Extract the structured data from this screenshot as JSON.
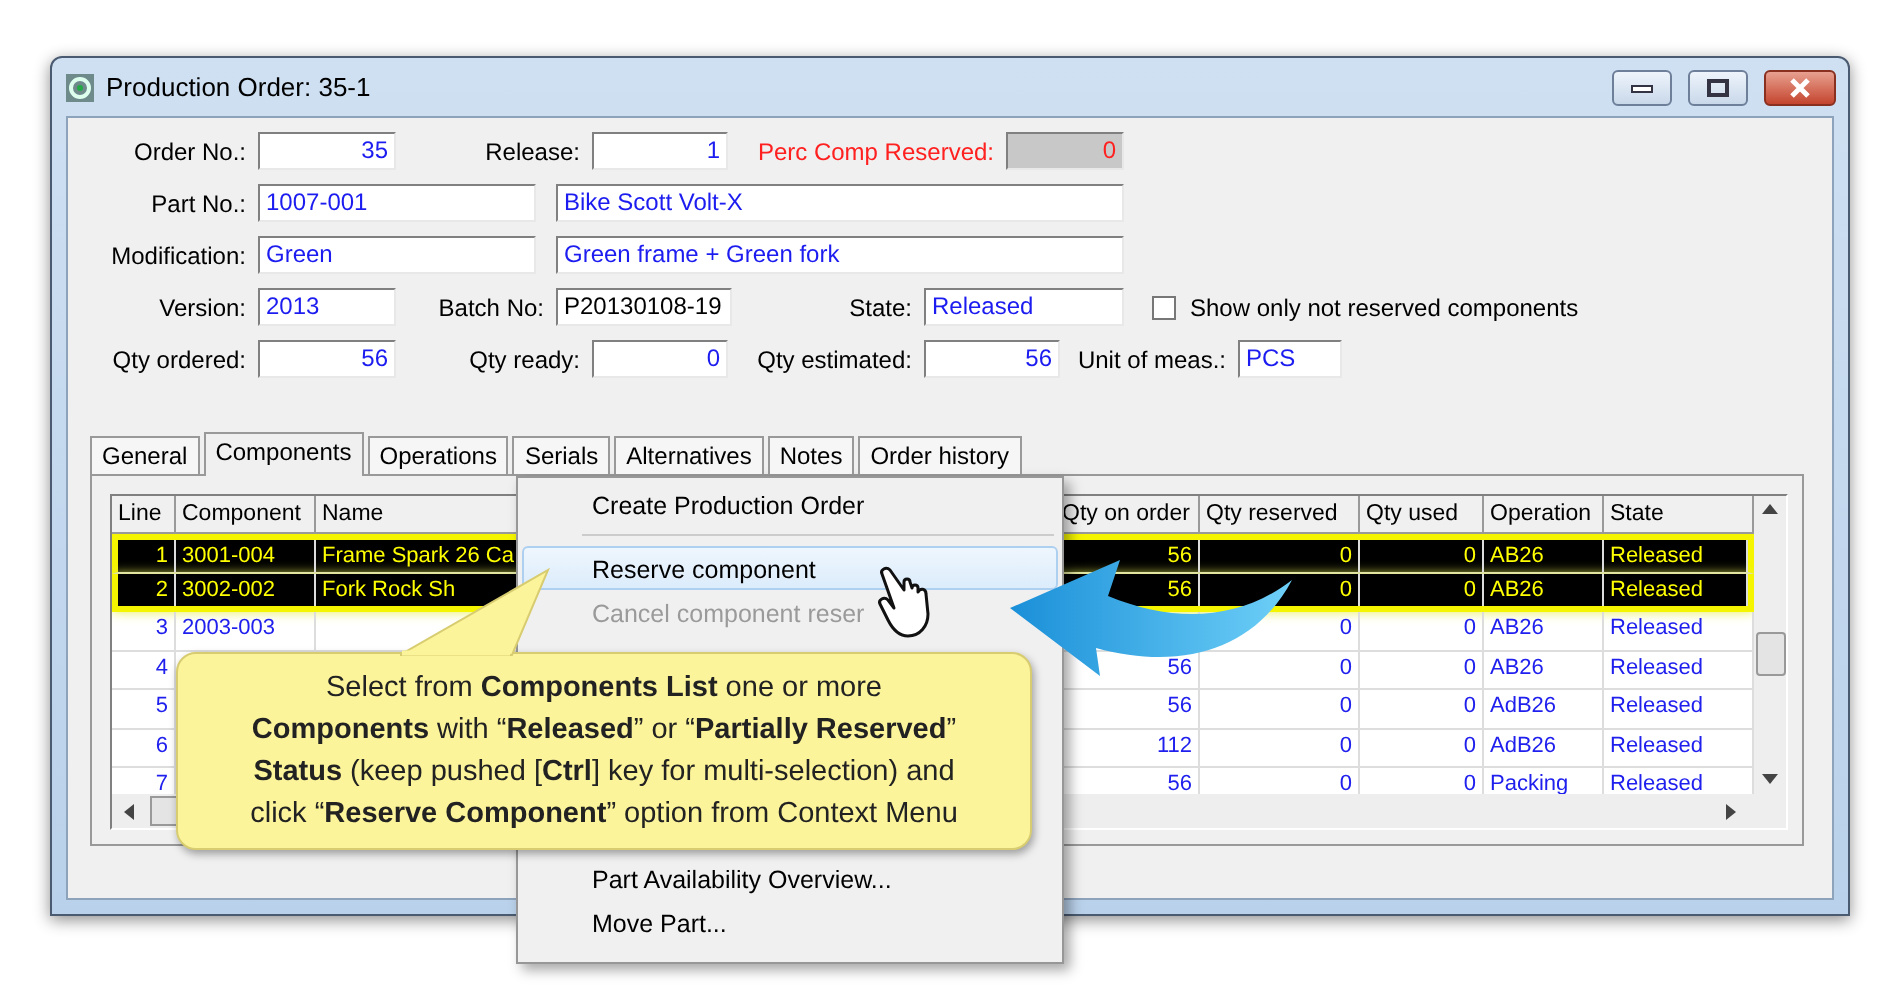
{
  "window": {
    "title": "Production Order: 35-1"
  },
  "form": {
    "rows": [
      [
        {
          "label": "Order No.:",
          "value": "35",
          "kind": "number",
          "readonly": false
        },
        {
          "label": "Release:",
          "value": "1",
          "kind": "number",
          "readonly": false
        },
        {
          "label": "Perc Comp Reserved:",
          "value": "0",
          "kind": "number",
          "readonly": true,
          "color": "#ff2020"
        }
      ],
      [
        {
          "label": "Part No.:",
          "value": "1007-001",
          "kind": "text",
          "readonly": false
        },
        {
          "value": "Bike Scott Volt-X",
          "kind": "text",
          "readonly": false
        }
      ],
      [
        {
          "label": "Modification:",
          "value": "Green",
          "kind": "text",
          "readonly": false
        },
        {
          "value": "Green frame + Green fork",
          "kind": "text",
          "readonly": false
        }
      ],
      [
        {
          "label": "Version:",
          "value": "2013",
          "kind": "text",
          "readonly": false
        },
        {
          "label": "Batch No:",
          "value": "P20130108-19",
          "kind": "plain",
          "readonly": false
        },
        {
          "label": "State:",
          "value": "Released",
          "kind": "text",
          "readonly": false
        },
        {
          "label": "Show only not reserved components",
          "kind": "checkbox",
          "checked": false
        }
      ],
      [
        {
          "label": "Qty ordered:",
          "value": "56",
          "kind": "number",
          "readonly": false
        },
        {
          "label": "Qty ready:",
          "value": "0",
          "kind": "number",
          "readonly": false
        },
        {
          "label": "Qty estimated:",
          "value": "56",
          "kind": "number",
          "readonly": false
        },
        {
          "label": "Unit of meas.:",
          "value": "PCS",
          "kind": "text",
          "readonly": false
        }
      ]
    ]
  },
  "tabs": [
    {
      "label": "General",
      "selected": false
    },
    {
      "label": "Components",
      "selected": true
    },
    {
      "label": "Operations",
      "selected": false
    },
    {
      "label": "Serials",
      "selected": false
    },
    {
      "label": "Alternatives",
      "selected": false
    },
    {
      "label": "Notes",
      "selected": false
    },
    {
      "label": "Order history",
      "selected": false
    }
  ],
  "table": {
    "columns": [
      "Line",
      "Component",
      "Name",
      "Qty on order",
      "Qty reserved",
      "Qty used",
      "Operation",
      "State"
    ],
    "rows": [
      {
        "selected": true,
        "line": "1",
        "component": "3001-004",
        "name": "Frame Spark 26 Ca",
        "qty_on_order": "56",
        "qty_reserved": "0",
        "qty_used": "0",
        "operation": "AB26",
        "state": "Released"
      },
      {
        "selected": true,
        "line": "2",
        "component": "3002-002",
        "name": "Fork Rock Sh",
        "qty_on_order": "56",
        "qty_reserved": "0",
        "qty_used": "0",
        "operation": "AB26",
        "state": "Released"
      },
      {
        "selected": false,
        "line": "3",
        "component": "2003-003",
        "qty_reserved": "0",
        "qty_used": "0",
        "operation": "AB26",
        "state": "Released"
      },
      {
        "selected": false,
        "line": "4",
        "qty_on_order": "56",
        "qty_reserved": "0",
        "qty_used": "0",
        "operation": "AB26",
        "state": "Released"
      },
      {
        "selected": false,
        "line": "5",
        "qty_on_order": "56",
        "qty_reserved": "0",
        "qty_used": "0",
        "operation": "AdB26",
        "state": "Released"
      },
      {
        "selected": false,
        "line": "6",
        "qty_on_order": "112",
        "qty_reserved": "0",
        "qty_used": "0",
        "operation": "AdB26",
        "state": "Released"
      },
      {
        "selected": false,
        "line": "7",
        "qty_on_order": "56",
        "qty_reserved": "0",
        "qty_used": "0",
        "operation": "Packing",
        "state": "Released"
      }
    ]
  },
  "context_menu": {
    "top_items": [
      {
        "kind": "item",
        "label": "Create Production Order",
        "selected": false,
        "disabled": false
      },
      {
        "kind": "separator"
      },
      {
        "kind": "item",
        "label": "Reserve component",
        "selected": true,
        "disabled": false
      },
      {
        "kind": "item",
        "label": "Cancel component reser",
        "selected": false,
        "disabled": true
      }
    ],
    "bottom_items": [
      {
        "kind": "item",
        "label": "Part Availability Overview...",
        "selected": false,
        "disabled": false
      },
      {
        "kind": "item",
        "label": "Move Part...",
        "selected": false,
        "disabled": false
      }
    ]
  },
  "callout": {
    "text": "Select from **Components List** one or more\n**Components** with “**Released**” or “**Partially Reserved**”\n**Status** (keep pushed [**Ctrl**] key for multi-selection) and\nclick “**Reserve Component**” option from Context Menu"
  }
}
